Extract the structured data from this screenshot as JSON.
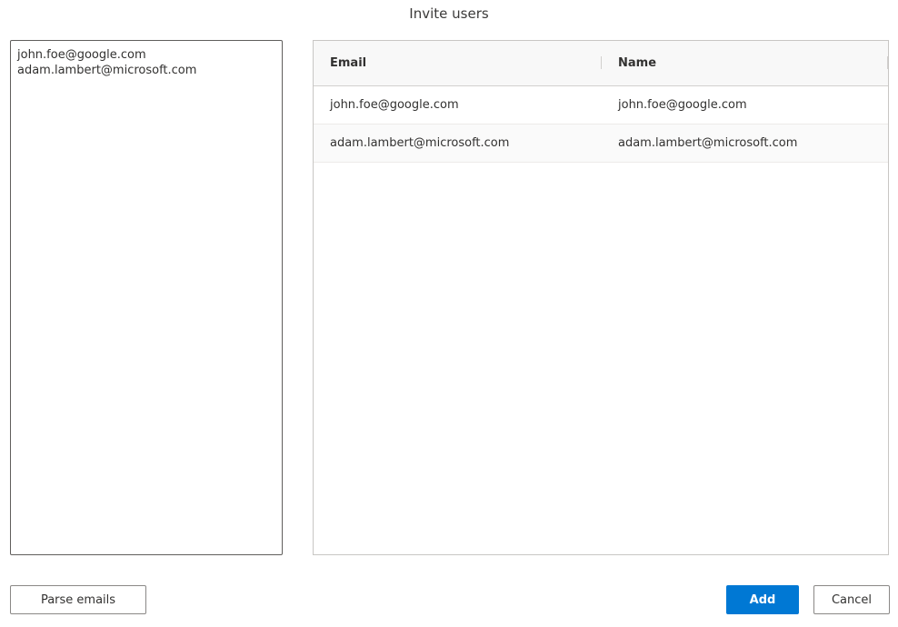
{
  "dialog": {
    "title": "Invite users"
  },
  "input": {
    "value": "john.foe@google.com\nadam.lambert@microsoft.com"
  },
  "grid": {
    "columns": [
      "Email",
      "Name"
    ],
    "rows": [
      {
        "email": "john.foe@google.com",
        "name": "john.foe@google.com"
      },
      {
        "email": "adam.lambert@microsoft.com",
        "name": "adam.lambert@microsoft.com"
      }
    ]
  },
  "buttons": {
    "parse_label": "Parse emails",
    "add_label": "Add",
    "cancel_label": "Cancel"
  },
  "colors": {
    "primary": "#0078d4",
    "border": "#8a8886"
  }
}
